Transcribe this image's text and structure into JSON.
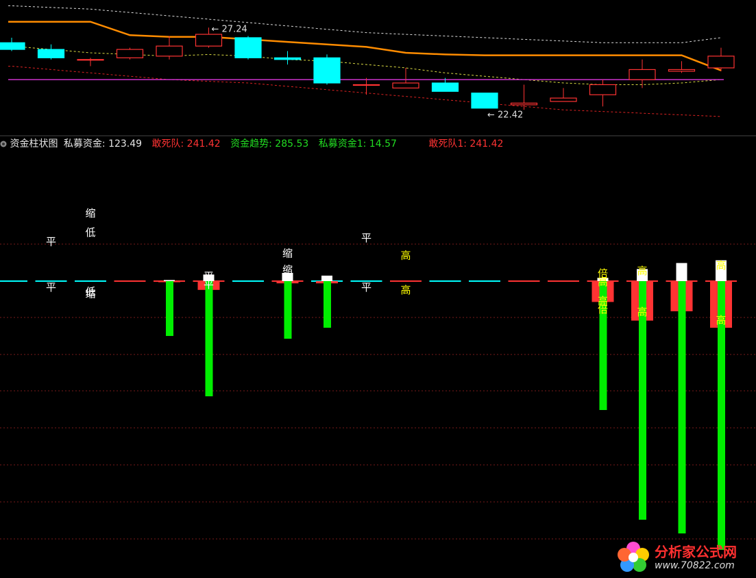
{
  "indicator_bar": {
    "title": "资金柱状图",
    "items": [
      {
        "label": "私募资金: 123.49",
        "color": "#e6e6e6"
      },
      {
        "label": "敢死队: 241.42",
        "color": "#ff3333"
      },
      {
        "label": "资金趋势: 285.53",
        "color": "#22dd22"
      },
      {
        "label": "私募资金1: 14.57",
        "color": "#22dd22"
      },
      {
        "label": "敢死队1: 241.42",
        "color": "#ff3333"
      }
    ]
  },
  "price_annotations": {
    "high_label": "27.24",
    "low_label": "22.42"
  },
  "watermark": {
    "name": "分析家公式网",
    "url": "www.70822.com"
  },
  "colors": {
    "up": "#ff3333",
    "down": "#00ffff",
    "orange": "#ff8c00",
    "magenta": "#cc33cc",
    "green": "#00ee00",
    "white": "#ffffff",
    "yellow": "#ffff00"
  },
  "chart_data": [
    {
      "type": "candlestick",
      "title": "",
      "ylim": [
        21.0,
        28.6
      ],
      "candles": [
        {
          "o": 26.3,
          "c": 25.9,
          "h": 26.6,
          "l": 25.8
        },
        {
          "o": 25.9,
          "c": 25.4,
          "h": 26.2,
          "l": 25.3
        },
        {
          "o": 25.3,
          "c": 25.3,
          "h": 25.4,
          "l": 24.9
        },
        {
          "o": 25.4,
          "c": 25.9,
          "h": 26.0,
          "l": 25.3
        },
        {
          "o": 25.5,
          "c": 26.1,
          "h": 26.7,
          "l": 25.3
        },
        {
          "o": 26.1,
          "c": 26.8,
          "h": 27.2,
          "l": 26.0
        },
        {
          "o": 26.6,
          "c": 25.4,
          "h": 26.7,
          "l": 25.3
        },
        {
          "o": 25.4,
          "c": 25.3,
          "h": 25.8,
          "l": 25.0
        },
        {
          "o": 25.4,
          "c": 23.9,
          "h": 25.6,
          "l": 23.8
        },
        {
          "o": 23.8,
          "c": 23.8,
          "h": 24.2,
          "l": 23.2
        },
        {
          "o": 23.6,
          "c": 23.9,
          "h": 24.8,
          "l": 23.6
        },
        {
          "o": 23.9,
          "c": 23.4,
          "h": 24.2,
          "l": 23.4
        },
        {
          "o": 23.3,
          "c": 22.4,
          "h": 23.3,
          "l": 22.4
        },
        {
          "o": 22.6,
          "c": 22.7,
          "h": 23.8,
          "l": 22.3
        },
        {
          "o": 22.8,
          "c": 23.0,
          "h": 23.6,
          "l": 22.8
        },
        {
          "o": 23.2,
          "c": 23.8,
          "h": 24.1,
          "l": 22.5
        },
        {
          "o": 24.1,
          "c": 24.7,
          "h": 25.3,
          "l": 23.6
        },
        {
          "o": 24.6,
          "c": 24.7,
          "h": 25.2,
          "l": 24.5
        },
        {
          "o": 24.8,
          "c": 25.5,
          "h": 26.0,
          "l": 24.6
        }
      ],
      "ma_orange": [
        27.55,
        27.55,
        27.55,
        26.75,
        26.65,
        26.65,
        26.5,
        26.35,
        26.2,
        26.05,
        25.7,
        25.6,
        25.55,
        25.55,
        25.55,
        25.55,
        25.55,
        25.55,
        24.65
      ],
      "ma_yellow_dashed": [
        26.1,
        25.9,
        25.7,
        25.6,
        25.5,
        25.6,
        25.5,
        25.3,
        25.2,
        25.0,
        24.8,
        24.5,
        24.3,
        24.1,
        23.9,
        23.8,
        23.8,
        23.9,
        24.1
      ],
      "band_upper": [
        28.5,
        28.4,
        28.3,
        28.1,
        27.9,
        27.7,
        27.5,
        27.3,
        27.1,
        26.9,
        26.8,
        26.7,
        26.6,
        26.5,
        26.4,
        26.3,
        26.3,
        26.3,
        26.6
      ],
      "band_lower": [
        24.9,
        24.7,
        24.5,
        24.3,
        24.1,
        24.0,
        23.9,
        23.7,
        23.5,
        23.3,
        23.1,
        22.9,
        22.7,
        22.5,
        22.3,
        22.2,
        22.1,
        22.0,
        21.9
      ],
      "magenta_level": 24.1
    },
    {
      "type": "bar",
      "title": "资金柱状图",
      "ylim": [
        -500,
        100
      ],
      "categories": [
        "1",
        "2",
        "3",
        "4",
        "5",
        "6",
        "7",
        "8",
        "9",
        "10",
        "11",
        "12",
        "13",
        "14",
        "15",
        "16",
        "17",
        "18",
        "19"
      ],
      "series": [
        {
          "name": "资金趋势",
          "values": [
            0,
            0,
            0,
            0,
            -100,
            -210,
            0,
            -105,
            -85,
            0,
            0,
            0,
            0,
            0,
            0,
            -235,
            -435,
            -460,
            -490
          ]
        },
        {
          "name": "敢死队",
          "values": [
            0,
            0,
            0,
            0,
            -2,
            -16,
            0,
            -4,
            -4,
            0,
            0,
            0,
            0,
            0,
            0,
            -38,
            -72,
            -55,
            -85
          ]
        },
        {
          "name": "私募资金",
          "values": [
            0,
            0,
            0,
            0,
            2,
            12,
            0,
            15,
            10,
            0,
            0,
            0,
            0,
            0,
            0,
            6,
            22,
            33,
            38
          ]
        }
      ],
      "zero_line_state": [
        "down",
        "down",
        "down",
        "up",
        "up",
        "up",
        "down",
        "up",
        "down",
        "down",
        "up",
        "down",
        "down",
        "up",
        "up",
        "up",
        "up",
        "up",
        "up"
      ],
      "labels": [
        {
          "i": 1,
          "v": 73,
          "text": "平",
          "color": "#ffffff"
        },
        {
          "i": 1,
          "v": -10,
          "text": "平",
          "color": "#ffffff"
        },
        {
          "i": 2,
          "v": 125,
          "text": "缩",
          "color": "#ffffff"
        },
        {
          "i": 2,
          "v": 90,
          "text": "低",
          "color": "#ffffff"
        },
        {
          "i": 2,
          "v": -18,
          "text": "低",
          "color": "#ffffff"
        },
        {
          "i": 2,
          "v": -22,
          "text": "缩",
          "color": "#ffffff"
        },
        {
          "i": 5,
          "v": 10,
          "text": "平",
          "color": "#ffffff"
        },
        {
          "i": 5,
          "v": -5,
          "text": "平",
          "color": "#ffffff"
        },
        {
          "i": 7,
          "v": 52,
          "text": "缩",
          "color": "#ffffff"
        },
        {
          "i": 7,
          "v": 22,
          "text": "缩",
          "color": "#ffffff"
        },
        {
          "i": 9,
          "v": 80,
          "text": "平",
          "color": "#ffffff"
        },
        {
          "i": 9,
          "v": -10,
          "text": "平",
          "color": "#ffffff"
        },
        {
          "i": 10,
          "v": 48,
          "text": "高",
          "color": "#ffff00"
        },
        {
          "i": 10,
          "v": -15,
          "text": "高",
          "color": "#ffff00"
        },
        {
          "i": 15,
          "v": 15,
          "text": "倍",
          "color": "#ffff00"
        },
        {
          "i": 15,
          "v": 0,
          "text": "高",
          "color": "#ffff00"
        },
        {
          "i": 15,
          "v": -35,
          "text": "高",
          "color": "#ffff00"
        },
        {
          "i": 15,
          "v": -50,
          "text": "倍",
          "color": "#ffff00"
        },
        {
          "i": 16,
          "v": 20,
          "text": "高",
          "color": "#ffff00"
        },
        {
          "i": 16,
          "v": -55,
          "text": "高",
          "color": "#ffff00"
        },
        {
          "i": 18,
          "v": 30,
          "text": "高",
          "color": "#ffff00"
        },
        {
          "i": 18,
          "v": -70,
          "text": "高",
          "color": "#ffff00"
        }
      ]
    }
  ]
}
